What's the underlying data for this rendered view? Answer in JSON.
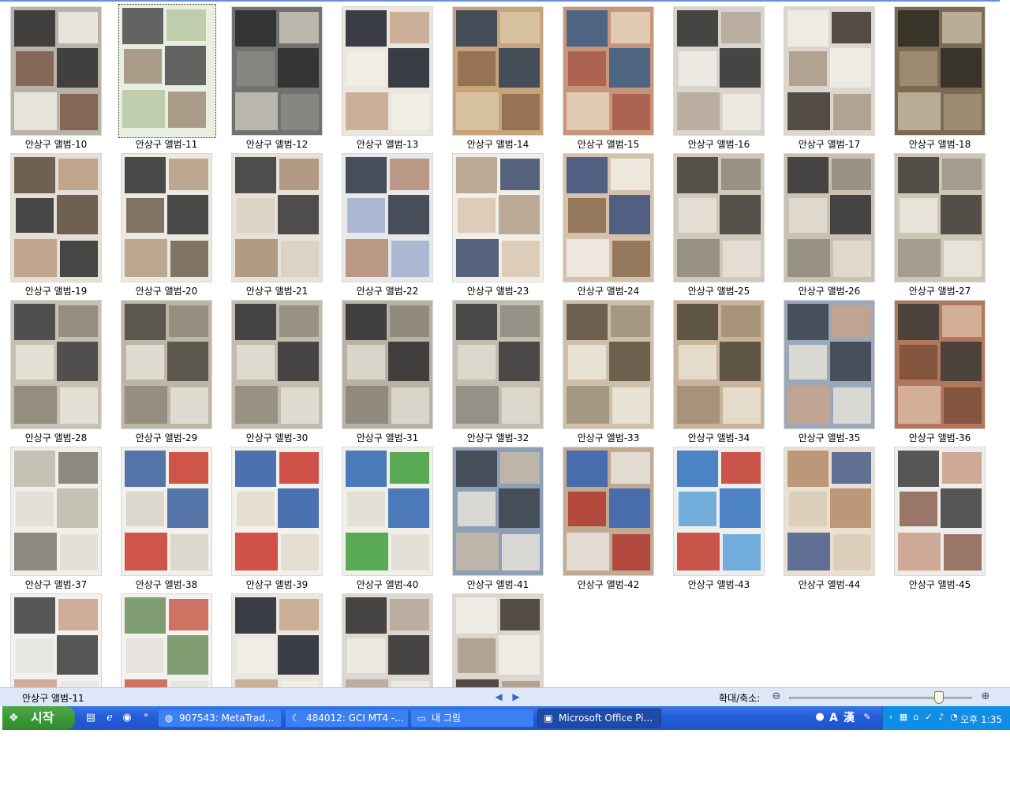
{
  "viewer": {
    "thumbnails": [
      {
        "label": "안상구 앨범-10",
        "palette": [
          "#b9b2a6",
          "#2c2c2c",
          "#efece6",
          "#7a5b46"
        ]
      },
      {
        "label": "안상구 앨범-11",
        "palette": [
          "#e8efe1",
          "#4b4b4b",
          "#b7c7a3",
          "#9d8e7a"
        ],
        "selected": true
      },
      {
        "label": "안상구 앨범-12",
        "palette": [
          "#6f7470",
          "#2a2a2a",
          "#c9c3b6",
          "#8c8a82"
        ]
      },
      {
        "label": "안상구 앨범-13",
        "palette": [
          "#e9e7de",
          "#1c1f2c",
          "#c6a48c",
          "#f2efe6"
        ]
      },
      {
        "label": "안상구 앨범-14",
        "palette": [
          "#c8a47c",
          "#2d3d52",
          "#d9c7a6",
          "#8d6b4f"
        ]
      },
      {
        "label": "안상구 앨범-15",
        "palette": [
          "#c6957a",
          "#3a5d86",
          "#e5d3be",
          "#a75a4a"
        ]
      },
      {
        "label": "안상구 앨범-16",
        "palette": [
          "#d8d4cc",
          "#2b2b2b",
          "#b5a799",
          "#f0ede6"
        ]
      },
      {
        "label": "안상구 앨범-17",
        "palette": [
          "#dcd6cc",
          "#f1eee7",
          "#3a342d",
          "#a99987"
        ]
      },
      {
        "label": "안상구 앨범-18",
        "palette": [
          "#7c6a52",
          "#2e2a23",
          "#c5b9a1",
          "#a09077"
        ]
      },
      {
        "label": "안상구 앨범-19",
        "palette": [
          "#e4e0d6",
          "#5a4a3a",
          "#b89b7f",
          "#2a2a2a"
        ]
      },
      {
        "label": "안상구 앨범-20",
        "palette": [
          "#ece9e2",
          "#2d2d2d",
          "#b49b82",
          "#6d5e4e"
        ]
      },
      {
        "label": "안상구 앨범-21",
        "palette": [
          "#e6e2da",
          "#333333",
          "#a88e76",
          "#d9cfc1"
        ]
      },
      {
        "label": "안상구 앨범-22",
        "palette": [
          "#e8e8ea",
          "#2a3140",
          "#b08a74",
          "#9fb0cc"
        ]
      },
      {
        "label": "안상구 앨범-23",
        "palette": [
          "#f2efe8",
          "#b29d86",
          "#3b4a6a",
          "#d8c6b0"
        ]
      },
      {
        "label": "안상구 앨범-24",
        "palette": [
          "#d5c2ad",
          "#3a4e7a",
          "#f1ede6",
          "#8a6a4e"
        ]
      },
      {
        "label": "안상구 앨범-25",
        "palette": [
          "#cfc8bb",
          "#3f3b35",
          "#8e887d",
          "#e6e1d7"
        ]
      },
      {
        "label": "안상구 앨범-26",
        "palette": [
          "#c9c2b3",
          "#2e2e2e",
          "#8f897e",
          "#e3ddd1"
        ]
      },
      {
        "label": "안상구 앨범-27",
        "palette": [
          "#cdc6b7",
          "#3d3a35",
          "#9b958a",
          "#ebe7df"
        ]
      },
      {
        "label": "안상구 앨범-28",
        "palette": [
          "#c7c1b4",
          "#3b3b3b",
          "#8b8578",
          "#e9e5dc"
        ]
      },
      {
        "label": "안상구 앨범-29",
        "palette": [
          "#bdb6a7",
          "#4a4740",
          "#8e877a",
          "#e6e2d8"
        ]
      },
      {
        "label": "안상구 앨범-30",
        "palette": [
          "#c2bcaf",
          "#2f2f2f",
          "#918b7e",
          "#e5e1d7"
        ]
      },
      {
        "label": "안상구 앨범-31",
        "palette": [
          "#b8b2a5",
          "#2a2a2a",
          "#8a8478",
          "#dedad0"
        ]
      },
      {
        "label": "안상구 앨범-32",
        "palette": [
          "#c3bdb0",
          "#353535",
          "#8e8a80",
          "#e2ddd3"
        ]
      },
      {
        "label": "안상구 앨범-33",
        "palette": [
          "#cdbfa8",
          "#5a5040",
          "#9d917c",
          "#ece7dc"
        ]
      },
      {
        "label": "안상구 앨범-34",
        "palette": [
          "#c9b39a",
          "#4c4435",
          "#a08d74",
          "#e9e2d4"
        ]
      },
      {
        "label": "안상구 앨범-35",
        "palette": [
          "#9aa8b8",
          "#3a3f4a",
          "#c6a58a",
          "#e5e0d7"
        ]
      },
      {
        "label": "안상구 앨범-36",
        "palette": [
          "#b1785e",
          "#3c3836",
          "#d9b9a2",
          "#7c4e3a"
        ]
      },
      {
        "label": "안상구 앨범-37",
        "palette": [
          "#f1efe9",
          "#bdb8ac",
          "#7c776c",
          "#e2ddd3"
        ]
      },
      {
        "label": "안상구 앨범-38",
        "palette": [
          "#f2f0ea",
          "#3a5e9c",
          "#c93a2c",
          "#d9d4c9"
        ]
      },
      {
        "label": "안상구 앨범-39",
        "palette": [
          "#f3f1ec",
          "#2d5aa6",
          "#c9352a",
          "#e0dbcf"
        ]
      },
      {
        "label": "안상구 앨범-40",
        "palette": [
          "#f0efe8",
          "#2e64b0",
          "#3f9c3a",
          "#e2ddd2"
        ]
      },
      {
        "label": "안상구 앨범-41",
        "palette": [
          "#8ea0b6",
          "#3a3f4a",
          "#c5b8a8",
          "#e6e2db"
        ]
      },
      {
        "label": "안상구 앨범-42",
        "palette": [
          "#c0aa92",
          "#3462b0",
          "#e8e4dc",
          "#b23a30"
        ]
      },
      {
        "label": "안상구 앨범-43",
        "palette": [
          "#eeeeec",
          "#2f6fc0",
          "#c23a2e",
          "#5aa0d8"
        ]
      },
      {
        "label": "안상구 앨범-44",
        "palette": [
          "#e8e1d2",
          "#b48a6a",
          "#4a5a8a",
          "#d9cdb8"
        ]
      },
      {
        "label": "안상구 앨범-45",
        "palette": [
          "#eeedea",
          "#3b3b3b",
          "#c99c88",
          "#8a6050"
        ]
      },
      {
        "label": "",
        "palette": [
          "#f2f1ee",
          "#3b3b3b",
          "#c9a088",
          "#e7e5e0"
        ]
      },
      {
        "label": "",
        "palette": [
          "#f3f2ef",
          "#6b8f5a",
          "#c85a4a",
          "#e4e2dc"
        ]
      },
      {
        "label": "",
        "palette": [
          "#e9e7de",
          "#1c1f2c",
          "#c6a48c",
          "#f2efe6"
        ]
      },
      {
        "label": "",
        "palette": [
          "#dcd8d0",
          "#2b2b2b",
          "#b5a799",
          "#f0ede6"
        ]
      },
      {
        "label": "",
        "palette": [
          "#dcd6cc",
          "#f1eee7",
          "#3a342d",
          "#a99987"
        ]
      }
    ]
  },
  "statusbar": {
    "current_file": "안상구 앨범-11",
    "zoom_label": "확대/축소:",
    "zoom_level": 0.82
  },
  "taskbar": {
    "start_label": "시작",
    "tasks": [
      {
        "label": "907543: MetaTrad...",
        "icon": "globe-icon",
        "active": false
      },
      {
        "label": "484012: GCI MT4 -...",
        "icon": "moon-icon",
        "active": false
      },
      {
        "label": "내 그림",
        "icon": "folder-icon",
        "active": false
      },
      {
        "label": "Microsoft Office Pi...",
        "icon": "picture-manager-icon",
        "active": true
      }
    ],
    "ime_labels": [
      "A",
      "漢"
    ],
    "clock": "오후 1:35"
  }
}
